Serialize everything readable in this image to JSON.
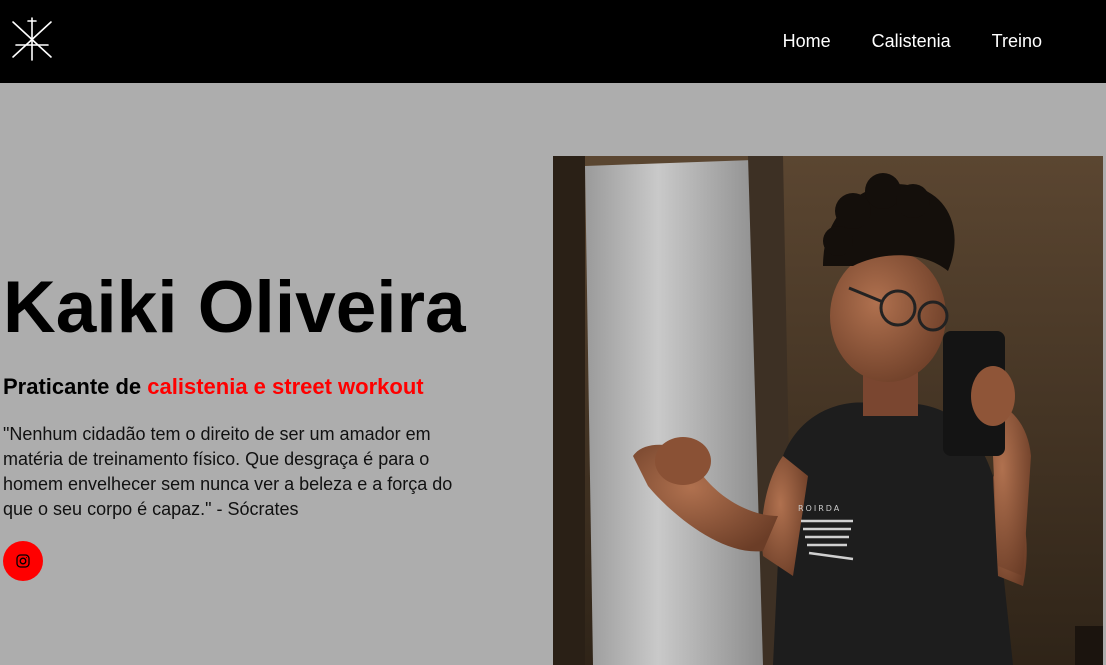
{
  "header": {
    "logo_icon": "crossed-lines-logo-icon",
    "nav": [
      {
        "label": "Home"
      },
      {
        "label": "Calistenia"
      },
      {
        "label": "Treino"
      }
    ]
  },
  "hero": {
    "name": "Kaiki Oliveira",
    "subtitle_prefix": "Praticante de ",
    "subtitle_accent": "calistenia e street workout",
    "quote": "\"Nenhum cidadão tem o direito de ser um amador em matéria de treinamento físico. Que desgraça é para o homem envelhecer sem nunca ver a beleza e a força do que o seu corpo é capaz.\" - Sócrates",
    "social_icon": "instagram-icon"
  },
  "colors": {
    "background": "#adadad",
    "header_bg": "#000000",
    "accent": "#ff0000"
  }
}
